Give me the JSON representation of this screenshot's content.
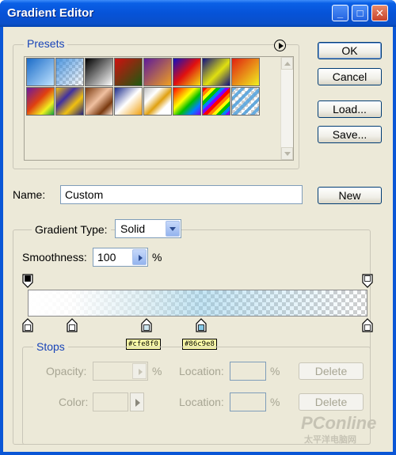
{
  "window": {
    "title": "Gradient Editor",
    "controls": {
      "minimize": "_",
      "maximize": "□",
      "close": "✕"
    }
  },
  "buttons": {
    "ok": "OK",
    "cancel": "Cancel",
    "load": "Load...",
    "save": "Save...",
    "new": "New"
  },
  "presets": {
    "legend": "Presets",
    "menu_icon": "circle-arrow-icon",
    "swatches": [
      "linear-gradient(135deg,#1b6cc8,#bfe3ff)",
      "checker:linear-gradient(135deg,rgba(60,140,220,0.9),rgba(60,140,220,0))",
      "linear-gradient(135deg,#000,#fff)",
      "linear-gradient(135deg,#d01010,#1c5a10)",
      "linear-gradient(135deg,#5e1a9a,#f0a020)",
      "linear-gradient(135deg,#1010c0,#e01010 50%,#f0e010)",
      "linear-gradient(135deg,#101080,#e0e010 55%,#101080)",
      "linear-gradient(135deg,#e02010,#f0f020)",
      "linear-gradient(135deg,#6a1aa0,#e04010 45%,#f0f020 75%,#10a040)",
      "linear-gradient(135deg,#f0c010,#4030a0 35%,#f0c010 65%,#202080)",
      "linear-gradient(135deg,#7a3a10,#f0c0a0 45%,#7a3a10 75%,#f8e0d0)",
      "linear-gradient(135deg,#1a2a8a,#ffffff 50%,#f0a010)",
      "linear-gradient(135deg,#c0c0c0,#ffffff 30%,#e0a010 55%,#ffffff 75%)",
      "linear-gradient(135deg,#ff0000,#ff8000,#ffff00,#00c000,#0080ff,#8000ff)",
      "checker:repeating-linear-gradient(135deg,#ff0000 0 4px,#ff8000 4px 8px,#ffff00 8px 12px,#00c000 12px 16px,#0080ff 16px 20px,#8000ff 20px 24px)",
      "checker:repeating-linear-gradient(135deg,rgba(80,160,220,0.85) 0 4px,rgba(255,255,255,0) 4px 8px)"
    ]
  },
  "name_field": {
    "label": "Name:",
    "value": "Custom"
  },
  "gradient": {
    "type_label": "Gradient Type:",
    "type_value": "Solid",
    "smoothness_label": "Smoothness:",
    "smoothness_value": "100",
    "smoothness_unit": "%",
    "color_stops": [
      {
        "hex": "#ffffff",
        "location": 0
      },
      {
        "hex": "#ffffff",
        "location": 13
      },
      {
        "hex": "#cfe8f0",
        "location": 35
      },
      {
        "hex": "#86c9e8",
        "location": 51
      },
      {
        "hex": "#ffffff",
        "location": 100
      }
    ],
    "opacity_stops": [
      {
        "opacity": 100,
        "location": 0
      },
      {
        "opacity": 0,
        "location": 100
      }
    ],
    "hex_tags": [
      "#cfe8f0",
      "#86c9e8"
    ]
  },
  "stops": {
    "legend": "Stops",
    "opacity_label": "Opacity:",
    "opacity_unit": "%",
    "color_label": "Color:",
    "location_label": "Location:",
    "location_unit": "%",
    "delete_label": "Delete"
  },
  "watermark": {
    "brand": "PConline",
    "tagline": "太平洋电脑网"
  }
}
